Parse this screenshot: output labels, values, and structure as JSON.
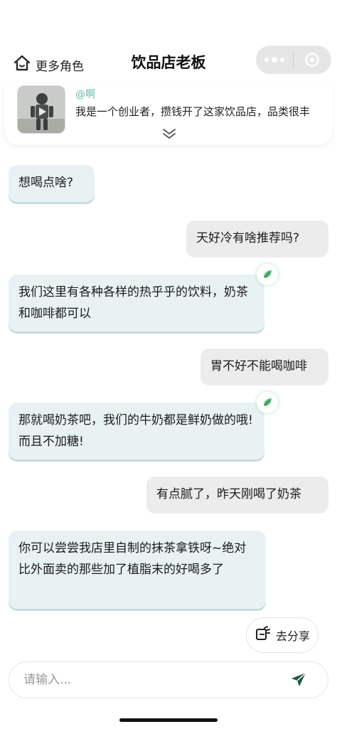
{
  "header": {
    "more_roles_label": "更多角色",
    "title": "饮品店老板"
  },
  "profile": {
    "handle": "@啊",
    "bio": "我是一个创业者，攒钱开了这家饮品店，品类很丰"
  },
  "messages": [
    {
      "role": "ai",
      "text": "想喝点啥?"
    },
    {
      "role": "user",
      "text": "天好冷有啥推荐吗?"
    },
    {
      "role": "ai",
      "text": "我们这里有各种各样的热乎乎的饮料，奶茶和咖啡都可以"
    },
    {
      "role": "user",
      "text": "胃不好不能喝咖啡"
    },
    {
      "role": "ai",
      "text": "那就喝奶茶吧，我们的牛奶都是鲜奶做的哦!而且不加糖!"
    },
    {
      "role": "user",
      "text": "有点腻了，昨天刚喝了奶茶"
    },
    {
      "role": "ai",
      "text": "你可以尝尝我店里自制的抹茶拿铁呀~绝对比外面卖的那些加了植脂末的好喝多了"
    }
  ],
  "share_label": "去分享",
  "input": {
    "placeholder": "请输入...",
    "value": ""
  },
  "icons": {
    "home": "home-icon",
    "more": "more-dots-icon",
    "close": "target-circle-icon",
    "expand": "double-chevron-down-icon",
    "badge": "leaf-badge-icon",
    "share": "share-icon",
    "send": "send-icon"
  },
  "colors": {
    "accent": "#5fb8a8",
    "send": "#1e5a4a",
    "ai_bubble": "#e9f2f3",
    "user_bubble": "#ececec"
  }
}
